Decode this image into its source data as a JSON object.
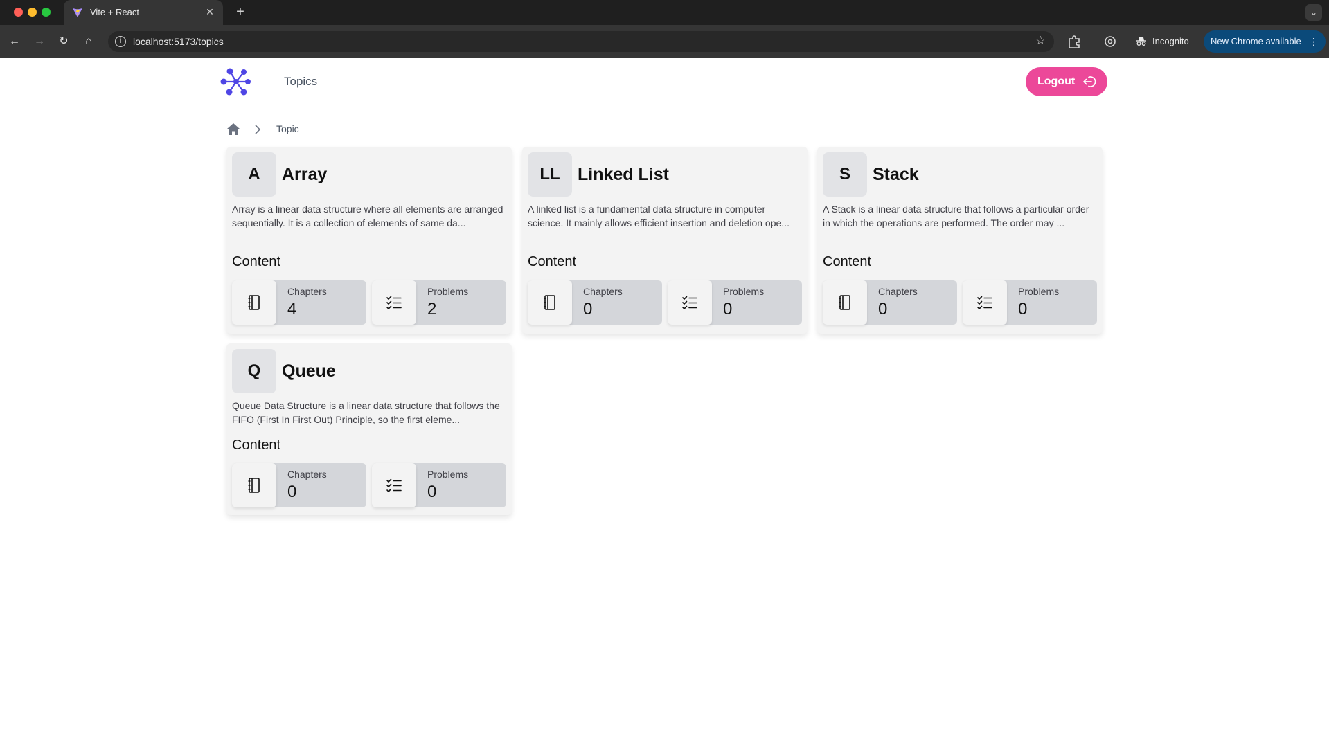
{
  "browser": {
    "tab_title": "Vite + React",
    "url": "localhost:5173/topics",
    "incognito_label": "Incognito",
    "update_label": "New Chrome available"
  },
  "header": {
    "nav_topics": "Topics",
    "logout_label": "Logout"
  },
  "breadcrumb": {
    "current": "Topic"
  },
  "content_label": "Content",
  "stat_labels": {
    "chapters": "Chapters",
    "problems": "Problems"
  },
  "topics": [
    {
      "initials": "A",
      "title": "Array",
      "description": "Array is a linear data structure where all elements are arranged sequentially. It is a collection of elements of same da...",
      "chapters": "4",
      "problems": "2"
    },
    {
      "initials": "LL",
      "title": "Linked List",
      "description": "A linked list is a fundamental data structure in computer science. It mainly allows efficient insertion and deletion ope...",
      "chapters": "0",
      "problems": "0"
    },
    {
      "initials": "S",
      "title": "Stack",
      "description": "A Stack is a linear data structure that follows a particular order in which the operations are performed. The order may ...",
      "chapters": "0",
      "problems": "0"
    },
    {
      "initials": "Q",
      "title": "Queue",
      "description": "Queue Data Structure is a linear data structure that follows the FIFO (First In First Out) Principle, so the first eleme...",
      "chapters": "0",
      "problems": "0"
    }
  ],
  "colors": {
    "logo": "#4f46e5",
    "logout_button": "#ec4899",
    "card_background": "#f3f3f3",
    "stat_background": "#d4d6da"
  }
}
